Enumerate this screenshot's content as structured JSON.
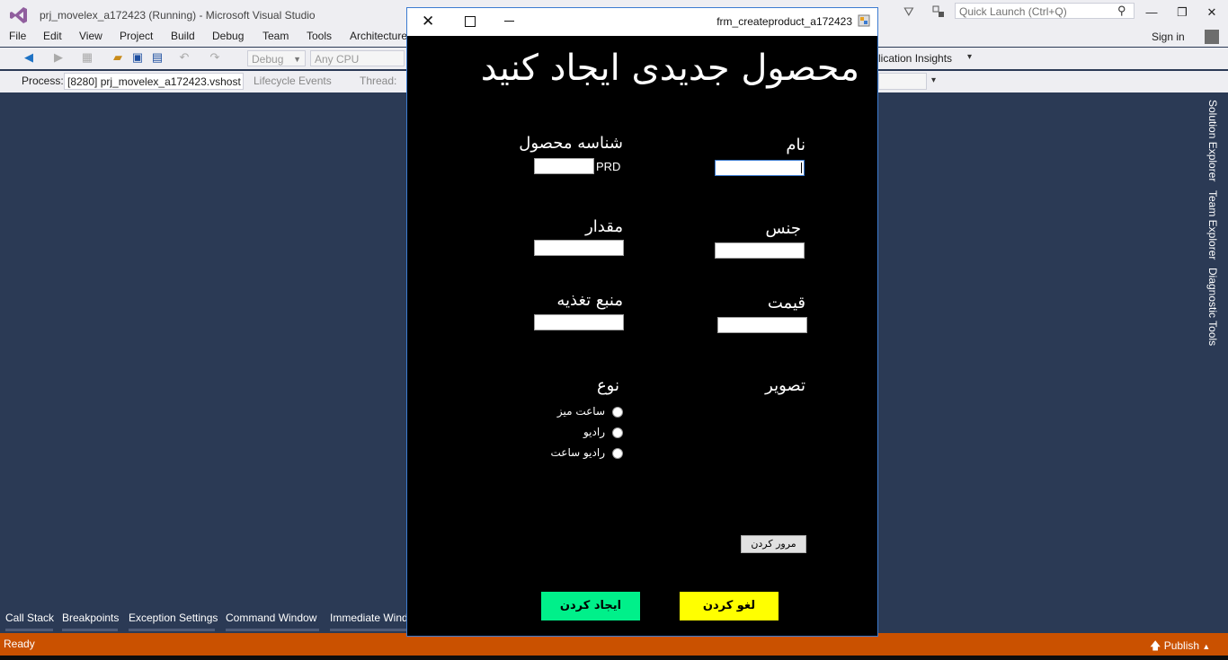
{
  "vs": {
    "title": "prj_movelex_a172423 (Running) - Microsoft Visual Studio",
    "quick_launch_placeholder": "Quick Launch (Ctrl+Q)",
    "menu": [
      "File",
      "Edit",
      "View",
      "Project",
      "Build",
      "Debug",
      "Team",
      "Tools",
      "Architecture"
    ],
    "sign_in": "Sign in",
    "toolbar": {
      "config": "Debug",
      "platform": "Any CPU",
      "app_insights": "lication Insights",
      "process_label": "Process:",
      "process_value": "[8280] prj_movelex_a172423.vshost",
      "lifecycle": "Lifecycle Events",
      "thread_label": "Thread:"
    },
    "right_tabs": [
      "Solution Explorer",
      "Team Explorer",
      "Diagnostic Tools"
    ],
    "bottom_tabs": [
      "Call Stack",
      "Breakpoints",
      "Exception Settings",
      "Command Window",
      "Immediate Wind"
    ],
    "status": {
      "ready": "Ready",
      "publish": "Publish",
      "color": "#ca5100"
    }
  },
  "dialog": {
    "title": "frm_createproduct_a172423",
    "heading": "محصول جدیدی ایجاد کنید",
    "fields": {
      "name_label": "نام",
      "product_id_label": "شناسه محصول",
      "product_id_prefix": "PRD",
      "gender_label": "جنس",
      "quantity_label": "مقدار",
      "price_label": "قیمت",
      "power_source_label": "منبع تغذیه",
      "image_label": "تصویر",
      "type_label": "نوع"
    },
    "type_options": [
      "ساعت میز",
      "رادیو",
      "رادیو ساعت"
    ],
    "buttons": {
      "browse": "مرور کردن",
      "create": "ایجاد کردن",
      "cancel": "لغو کردن"
    },
    "colors": {
      "create": "#00f08a",
      "cancel": "#ffff00",
      "background": "#000000"
    }
  }
}
